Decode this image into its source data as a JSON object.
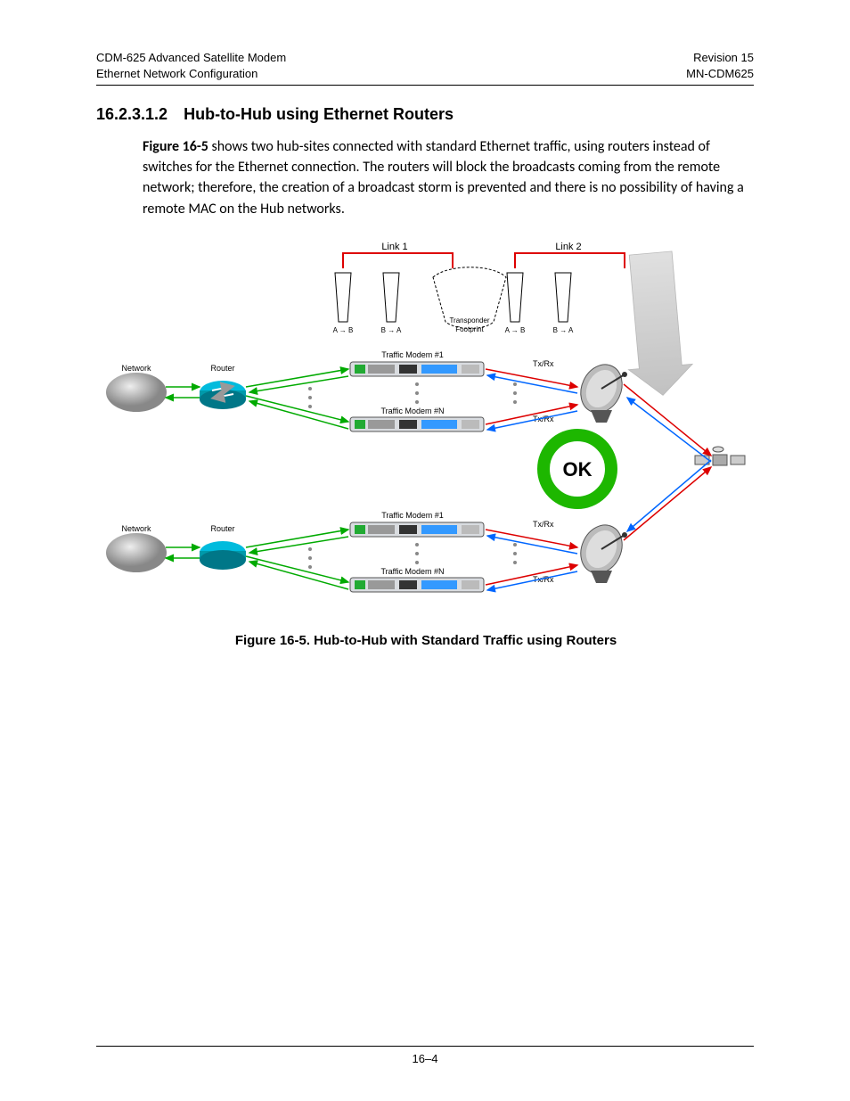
{
  "header": {
    "left_line1": "CDM-625 Advanced Satellite Modem",
    "left_line2": "Ethernet Network Configuration",
    "right_line1": "Revision 15",
    "right_line2": "MN-CDM625"
  },
  "section": {
    "number": "16.2.3.1.2",
    "title": "Hub-to-Hub using Ethernet Routers"
  },
  "paragraph": {
    "figref": "Figure 16-5",
    "rest": " shows two hub-sites connected with standard Ethernet traffic, using routers instead of switches for the Ethernet connection. The routers will block the broadcasts coming from the remote network; therefore, the creation of a broadcast storm is prevented and there is no possibility of having a remote MAC on the Hub networks."
  },
  "diagram": {
    "link1": "Link 1",
    "link2": "Link 2",
    "ab": "A → B",
    "ba": "B → A",
    "transponder1": "Transponder",
    "transponder2": "Footprint",
    "traffic1": "Traffic Modem #1",
    "trafficN": "Traffic Modem #N",
    "txrx": "Tx/Rx",
    "network": "Network",
    "router": "Router",
    "ok": "OK"
  },
  "figure_caption": "Figure 16-5. Hub-to-Hub with Standard Traffic using Routers",
  "footer": {
    "page": "16–4"
  }
}
